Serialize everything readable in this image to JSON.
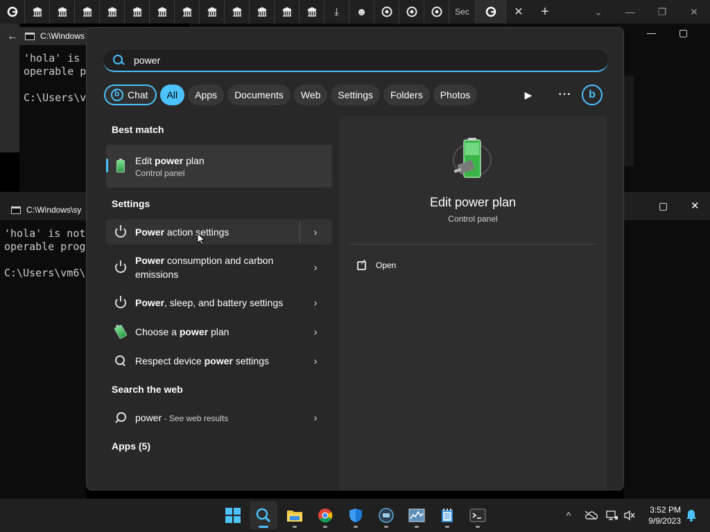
{
  "browser": {
    "tab_sec_label": "Sec",
    "close_tab": "✕",
    "new_tab": "+"
  },
  "consoles": [
    {
      "title": "C:\\Windows",
      "line1": "'hola' is",
      "line2": "operable p",
      "line3": "C:\\Users\\v",
      "minimize": "—",
      "maximize": "▢"
    },
    {
      "title": "C:\\Windows\\sy",
      "line1": "'hola' is not",
      "line2": "operable prog",
      "line3": "C:\\Users\\vm6\\",
      "maximize": "▢",
      "close": "✕"
    }
  ],
  "search": {
    "value": "power",
    "filters": [
      {
        "label": "Chat"
      },
      {
        "label": "All"
      },
      {
        "label": "Apps"
      },
      {
        "label": "Documents"
      },
      {
        "label": "Web"
      },
      {
        "label": "Settings"
      },
      {
        "label": "Folders"
      },
      {
        "label": "Photos"
      }
    ],
    "play": "▶",
    "more": "···",
    "bing": "b"
  },
  "results": {
    "best_match_header": "Best match",
    "best": {
      "title_pre": "Edit ",
      "title_bold": "power",
      "title_post": " plan",
      "subtitle": "Control panel"
    },
    "settings_header": "Settings",
    "settings": [
      {
        "bold": "Power",
        "rest": " action settings"
      },
      {
        "bold": "Power",
        "rest": " consumption and carbon",
        "rest2": "emissions"
      },
      {
        "bold": "Power",
        "rest": ", sleep, and battery settings"
      },
      {
        "pre": "Choose a ",
        "bold": "power",
        "rest": " plan"
      },
      {
        "pre": "Respect device ",
        "bold": "power",
        "rest": " settings"
      }
    ],
    "web_header": "Search the web",
    "web": {
      "query": "power",
      "suffix": " - See web results"
    },
    "apps_header": "Apps (5)",
    "chevron": "›"
  },
  "detail": {
    "title": "Edit power plan",
    "subtitle": "Control panel",
    "open_label": "Open"
  },
  "taskbar": {
    "time": "3:52 PM",
    "date": "9/9/2023",
    "tray_chevron": "^"
  },
  "colors": {
    "accent": "#4cc2ff",
    "flyout_bg": "#282828",
    "taskbar_bg": "#202020"
  }
}
